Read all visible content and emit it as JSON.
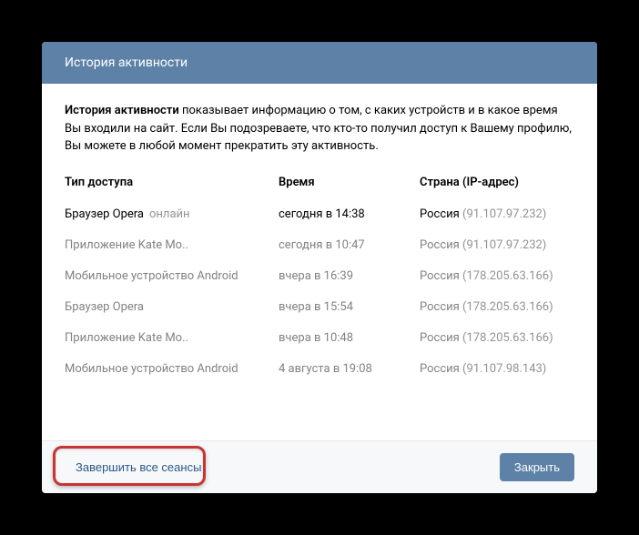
{
  "header": {
    "title": "История активности"
  },
  "description": {
    "bold": "История активности",
    "text": " показывает информацию о том, с каких устройств и в какое время Вы входили на сайт. Если Вы подозреваете, что кто-то получил доступ к Вашему профилю, Вы можете в любой момент прекратить эту активность."
  },
  "columns": {
    "device": "Тип доступа",
    "time": "Время",
    "country": "Страна (IP-адрес)"
  },
  "online_label": "онлайн",
  "sessions": [
    {
      "device": "Браузер Opera",
      "online": true,
      "time": "сегодня в 14:38",
      "country": "Россия",
      "ip": "(91.107.97.232)",
      "current": true
    },
    {
      "device": "Приложение Kate Mo..",
      "online": false,
      "time": "сегодня в 10:47",
      "country": "Россия",
      "ip": "(91.107.97.232)",
      "current": false
    },
    {
      "device": "Мобильное устройство Android",
      "online": false,
      "time": "вчера в 16:39",
      "country": "Россия",
      "ip": "(178.205.63.166)",
      "current": false
    },
    {
      "device": "Браузер Opera",
      "online": false,
      "time": "вчера в 15:54",
      "country": "Россия",
      "ip": "(178.205.63.166)",
      "current": false
    },
    {
      "device": "Приложение Kate Mo..",
      "online": false,
      "time": "вчера в 10:48",
      "country": "Россия",
      "ip": "(178.205.63.166)",
      "current": false
    },
    {
      "device": "Мобильное устройство Android",
      "online": false,
      "time": "4 августа в 19:08",
      "country": "Россия",
      "ip": "(91.107.98.143)",
      "current": false
    }
  ],
  "footer": {
    "end_all": "Завершить все сеансы",
    "close": "Закрыть"
  }
}
